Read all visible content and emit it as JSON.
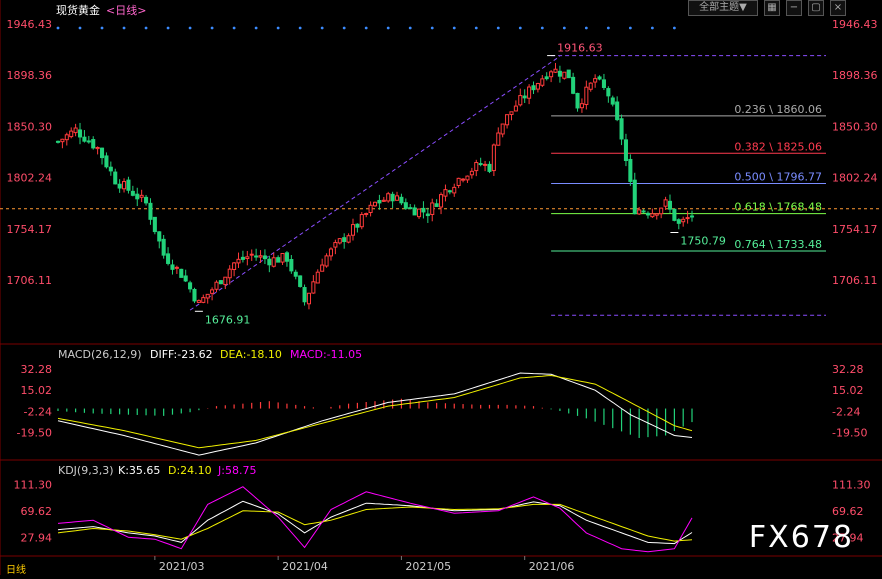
{
  "header": {
    "symbol": "现货黄金",
    "period": "<日线>",
    "theme_button": "全部主题▼",
    "macd_name": "MACD(26,12,9)",
    "macd_diff": "DIFF:-23.62",
    "macd_dea": "DEA:-18.10",
    "macd_val": "MACD:-11.05",
    "kdj_name": "KDJ(9,3,3)",
    "kdj_k": "K:35.65",
    "kdj_d": "D:24.10",
    "kdj_j": "J:58.75",
    "period_tag": "日线",
    "watermark": "FX678"
  },
  "colors": {
    "up": "#ff3b3b",
    "down": "#22d27a",
    "axis_label": "#ff4d6a",
    "date_label": "#cccccc",
    "fib_236": "#aaaaaa",
    "fib_382": "#ff3b4f",
    "fib_500": "#7a8cff",
    "fib_618": "#7cff4a",
    "fib_764": "#55ee99",
    "macd_diff": "#ffffff",
    "macd_dea": "#f0f000",
    "macd_hist": "#ff00ff",
    "kdj_k": "#ffffff",
    "kdj_d": "#f0f000",
    "kdj_j": "#ff00ff"
  },
  "chart_data": [
    {
      "type": "candlestick",
      "title": "",
      "yticks": [
        "1946.43",
        "1898.36",
        "1850.30",
        "1802.24",
        "1754.17",
        "1706.11"
      ],
      "ylim": [
        1650,
        1950
      ],
      "x_dates": [
        "2021/03",
        "2021/04",
        "2021/05",
        "2021/06"
      ],
      "x_date_index": [
        22,
        50,
        78,
        106
      ],
      "n_bars": 145,
      "current_price": 1773,
      "annotations": [
        {
          "text": "1916.63",
          "x": 112,
          "y": 1916.63,
          "kind": "high"
        },
        {
          "text": "1676.91",
          "x": 32,
          "y": 1676.91,
          "kind": "low"
        },
        {
          "text": "1750.79",
          "x": 140,
          "y": 1750.79,
          "kind": "low"
        }
      ],
      "fib_levels": [
        {
          "label": "0.236 \\ 1860.06",
          "value": 1860.06,
          "color": "fib_236"
        },
        {
          "label": "0.382 \\ 1825.06",
          "value": 1825.06,
          "color": "fib_382"
        },
        {
          "label": "0.500 \\ 1796.77",
          "value": 1796.77,
          "color": "fib_500"
        },
        {
          "label": "0.618 \\ 1768.48",
          "value": 1768.48,
          "color": "fib_618"
        },
        {
          "label": "0.764 \\ 1733.48",
          "value": 1733.48,
          "color": "fib_764"
        }
      ],
      "fib_top": 1916.63,
      "fib_bottom": 1676.91,
      "fib_start_index": 112,
      "trend_channel": {
        "from": [
          30,
          1678
        ],
        "to": [
          114,
          1916
        ]
      },
      "ohlc_keypoints": [
        [
          0,
          1836
        ],
        [
          4,
          1847
        ],
        [
          9,
          1830
        ],
        [
          13,
          1800
        ],
        [
          17,
          1788
        ],
        [
          20,
          1778
        ],
        [
          24,
          1730
        ],
        [
          28,
          1712
        ],
        [
          32,
          1684
        ],
        [
          36,
          1702
        ],
        [
          40,
          1722
        ],
        [
          44,
          1730
        ],
        [
          48,
          1725
        ],
        [
          52,
          1727
        ],
        [
          56,
          1686
        ],
        [
          60,
          1724
        ],
        [
          64,
          1742
        ],
        [
          68,
          1758
        ],
        [
          72,
          1778
        ],
        [
          76,
          1785
        ],
        [
          80,
          1773
        ],
        [
          84,
          1770
        ],
        [
          88,
          1790
        ],
        [
          92,
          1805
        ],
        [
          96,
          1815
        ],
        [
          98,
          1812
        ],
        [
          100,
          1848
        ],
        [
          104,
          1870
        ],
        [
          108,
          1888
        ],
        [
          112,
          1904
        ],
        [
          116,
          1898
        ],
        [
          118,
          1870
        ],
        [
          122,
          1895
        ],
        [
          125,
          1880
        ],
        [
          128,
          1840
        ],
        [
          131,
          1773
        ],
        [
          135,
          1770
        ],
        [
          138,
          1778
        ],
        [
          141,
          1758
        ],
        [
          144,
          1767
        ]
      ]
    },
    {
      "type": "line",
      "title": "MACD",
      "yticks": [
        "32.28",
        "15.02",
        "-2.24",
        "-19.50"
      ],
      "ylim": [
        -42,
        38
      ],
      "series": [
        {
          "name": "DIFF",
          "key": "macd_diff",
          "points": [
            [
              0,
              -10
            ],
            [
              15,
              -22
            ],
            [
              32,
              -38
            ],
            [
              45,
              -28
            ],
            [
              60,
              -10
            ],
            [
              75,
              5
            ],
            [
              90,
              12
            ],
            [
              105,
              29
            ],
            [
              112,
              28
            ],
            [
              122,
              15
            ],
            [
              130,
              -5
            ],
            [
              140,
              -22
            ],
            [
              144,
              -23.62
            ]
          ]
        },
        {
          "name": "DEA",
          "key": "macd_dea",
          "points": [
            [
              0,
              -8
            ],
            [
              15,
              -18
            ],
            [
              32,
              -32
            ],
            [
              45,
              -26
            ],
            [
              60,
              -12
            ],
            [
              75,
              2
            ],
            [
              90,
              9
            ],
            [
              105,
              25
            ],
            [
              112,
              27
            ],
            [
              122,
              20
            ],
            [
              130,
              5
            ],
            [
              140,
              -14
            ],
            [
              144,
              -18.1
            ]
          ]
        }
      ],
      "histogram": [
        [
          0,
          -2
        ],
        [
          8,
          -4
        ],
        [
          16,
          -5
        ],
        [
          24,
          -6
        ],
        [
          30,
          -3
        ],
        [
          36,
          2
        ],
        [
          42,
          4
        ],
        [
          48,
          6
        ],
        [
          54,
          3
        ],
        [
          60,
          0
        ],
        [
          66,
          4
        ],
        [
          72,
          6
        ],
        [
          78,
          8
        ],
        [
          84,
          5
        ],
        [
          90,
          4
        ],
        [
          96,
          3
        ],
        [
          102,
          3
        ],
        [
          108,
          2
        ],
        [
          114,
          -2
        ],
        [
          120,
          -8
        ],
        [
          126,
          -16
        ],
        [
          132,
          -24
        ],
        [
          138,
          -22
        ],
        [
          144,
          -11.05
        ]
      ]
    },
    {
      "type": "line",
      "title": "KDJ",
      "yticks": [
        "111.30",
        "69.62",
        "27.94"
      ],
      "ylim": [
        0,
        125
      ],
      "series": [
        {
          "name": "K",
          "key": "kdj_k",
          "points": [
            [
              0,
              40
            ],
            [
              8,
              45
            ],
            [
              16,
              35
            ],
            [
              22,
              30
            ],
            [
              28,
              20
            ],
            [
              34,
              55
            ],
            [
              42,
              85
            ],
            [
              50,
              65
            ],
            [
              56,
              35
            ],
            [
              62,
              60
            ],
            [
              70,
              82
            ],
            [
              80,
              78
            ],
            [
              90,
              70
            ],
            [
              100,
              72
            ],
            [
              108,
              84
            ],
            [
              114,
              78
            ],
            [
              120,
              55
            ],
            [
              128,
              35
            ],
            [
              134,
              20
            ],
            [
              140,
              18
            ],
            [
              144,
              35.65
            ]
          ]
        },
        {
          "name": "D",
          "key": "kdj_d",
          "points": [
            [
              0,
              35
            ],
            [
              8,
              42
            ],
            [
              16,
              38
            ],
            [
              22,
              32
            ],
            [
              28,
              25
            ],
            [
              34,
              42
            ],
            [
              42,
              70
            ],
            [
              50,
              68
            ],
            [
              56,
              48
            ],
            [
              62,
              55
            ],
            [
              70,
              72
            ],
            [
              80,
              76
            ],
            [
              90,
              72
            ],
            [
              100,
              73
            ],
            [
              108,
              80
            ],
            [
              114,
              80
            ],
            [
              120,
              65
            ],
            [
              128,
              45
            ],
            [
              134,
              30
            ],
            [
              140,
              22
            ],
            [
              144,
              24.1
            ]
          ]
        },
        {
          "name": "J",
          "key": "kdj_j",
          "points": [
            [
              0,
              50
            ],
            [
              8,
              55
            ],
            [
              16,
              28
            ],
            [
              22,
              25
            ],
            [
              28,
              10
            ],
            [
              34,
              80
            ],
            [
              42,
              108
            ],
            [
              50,
              60
            ],
            [
              56,
              12
            ],
            [
              62,
              72
            ],
            [
              70,
              100
            ],
            [
              80,
              82
            ],
            [
              90,
              66
            ],
            [
              100,
              70
            ],
            [
              108,
              92
            ],
            [
              114,
              74
            ],
            [
              120,
              35
            ],
            [
              128,
              10
            ],
            [
              134,
              5
            ],
            [
              140,
              10
            ],
            [
              144,
              58.75
            ]
          ]
        }
      ]
    }
  ]
}
